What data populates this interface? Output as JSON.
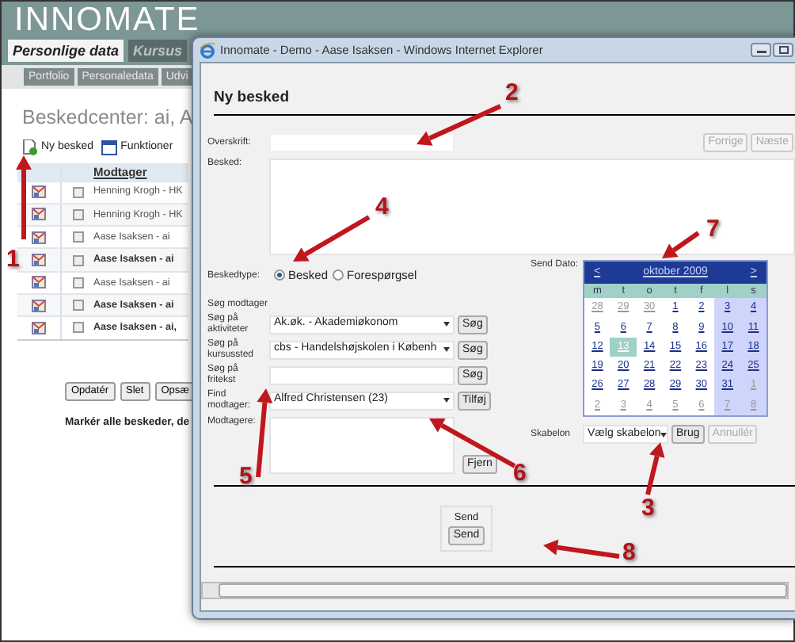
{
  "app": {
    "logo": "INNOMATE",
    "tabs": [
      {
        "label": "Personlige data",
        "selected": true
      },
      {
        "label": "Kursus",
        "selected": false
      }
    ],
    "subtabs": [
      "Portfolio",
      "Personaledata",
      "Udvi"
    ],
    "title": "Beskedcenter: ai, A",
    "toolbar": [
      {
        "label": "Ny besked",
        "kind": "new"
      },
      {
        "label": "Funktioner",
        "kind": "functions"
      }
    ],
    "table": {
      "columns": [
        "Modtager"
      ],
      "rows": [
        {
          "recipient": "Henning Krogh - HK",
          "unread": false,
          "checked": false
        },
        {
          "recipient": "Henning Krogh - HK",
          "unread": false,
          "checked": false
        },
        {
          "recipient": "Aase Isaksen - ai",
          "unread": false,
          "checked": false
        },
        {
          "recipient": "Aase Isaksen - ai",
          "unread": true,
          "checked": false
        },
        {
          "recipient": "Aase Isaksen - ai",
          "unread": false,
          "checked": false
        },
        {
          "recipient": "Aase Isaksen - ai",
          "unread": true,
          "checked": false
        },
        {
          "recipient": "Aase Isaksen - ai,",
          "unread": true,
          "checked": false
        }
      ]
    },
    "buttons": [
      "Opdatér",
      "Slet",
      "Opsæ"
    ],
    "note": "Markér alle beskeder, de"
  },
  "window": {
    "title": "Innomate - Demo - Aase Isaksen - Windows Internet Explorer",
    "heading": "Ny besked",
    "overskrift": {
      "label": "Overskrift:"
    },
    "nav_buttons": [
      {
        "label": "Forrige",
        "disabled": true
      },
      {
        "label": "Næste",
        "disabled": true
      }
    ],
    "besked": {
      "label": "Besked:"
    },
    "type": {
      "label": "Beskedtype:",
      "options": [
        {
          "label": "Besked",
          "selected": true
        },
        {
          "label": "Forespørgsel",
          "selected": false
        }
      ]
    },
    "search_title": "Søg modtager",
    "search_rows": [
      {
        "kind": "select",
        "label": "Søg på aktiviteter",
        "value": "Ak.øk. - Akademiøkonom",
        "button": "Søg"
      },
      {
        "kind": "select",
        "label": "Søg på kursussted",
        "value": "cbs - Handelshøjskolen i Københ",
        "button": "Søg"
      },
      {
        "kind": "input",
        "label": "Søg på fritekst",
        "button": "Søg"
      },
      {
        "kind": "select",
        "label": "Find modtager:",
        "value": "Alfred Christensen (23)",
        "button": "Tilføj"
      },
      {
        "kind": "list",
        "label": "Modtagere:",
        "button": "Fjern"
      }
    ],
    "send_date": {
      "label": "Send Dato:",
      "calendar": {
        "prev": "<",
        "month": "oktober 2009",
        "next": ">",
        "weekdays": [
          "m",
          "t",
          "o",
          "t",
          "f",
          "l",
          "s"
        ],
        "weeks": [
          [
            {
              "day": "28",
              "other_month": true,
              "selected": false
            },
            {
              "day": "29",
              "other_month": true,
              "selected": false
            },
            {
              "day": "30",
              "other_month": true,
              "selected": false
            },
            {
              "day": "1",
              "other_month": false,
              "selected": false
            },
            {
              "day": "2",
              "other_month": false,
              "selected": false
            },
            {
              "day": "3",
              "other_month": false,
              "selected": false
            },
            {
              "day": "4",
              "other_month": false,
              "selected": false
            }
          ],
          [
            {
              "day": "5",
              "other_month": false,
              "selected": false
            },
            {
              "day": "6",
              "other_month": false,
              "selected": false
            },
            {
              "day": "7",
              "other_month": false,
              "selected": false
            },
            {
              "day": "8",
              "other_month": false,
              "selected": false
            },
            {
              "day": "9",
              "other_month": false,
              "selected": false
            },
            {
              "day": "10",
              "other_month": false,
              "selected": false
            },
            {
              "day": "11",
              "other_month": false,
              "selected": false
            }
          ],
          [
            {
              "day": "12",
              "other_month": false,
              "selected": false
            },
            {
              "day": "13",
              "other_month": false,
              "selected": true
            },
            {
              "day": "14",
              "other_month": false,
              "selected": false
            },
            {
              "day": "15",
              "other_month": false,
              "selected": false
            },
            {
              "day": "16",
              "other_month": false,
              "selected": false
            },
            {
              "day": "17",
              "other_month": false,
              "selected": false
            },
            {
              "day": "18",
              "other_month": false,
              "selected": false
            }
          ],
          [
            {
              "day": "19",
              "other_month": false,
              "selected": false
            },
            {
              "day": "20",
              "other_month": false,
              "selected": false
            },
            {
              "day": "21",
              "other_month": false,
              "selected": false
            },
            {
              "day": "22",
              "other_month": false,
              "selected": false
            },
            {
              "day": "23",
              "other_month": false,
              "selected": false
            },
            {
              "day": "24",
              "other_month": false,
              "selected": false
            },
            {
              "day": "25",
              "other_month": false,
              "selected": false
            }
          ],
          [
            {
              "day": "26",
              "other_month": false,
              "selected": false
            },
            {
              "day": "27",
              "other_month": false,
              "selected": false
            },
            {
              "day": "28",
              "other_month": false,
              "selected": false
            },
            {
              "day": "29",
              "other_month": false,
              "selected": false
            },
            {
              "day": "30",
              "other_month": false,
              "selected": false
            },
            {
              "day": "31",
              "other_month": false,
              "selected": false
            },
            {
              "day": "1",
              "other_month": true,
              "selected": false
            }
          ],
          [
            {
              "day": "2",
              "other_month": true,
              "selected": false
            },
            {
              "day": "3",
              "other_month": true,
              "selected": false
            },
            {
              "day": "4",
              "other_month": true,
              "selected": false
            },
            {
              "day": "5",
              "other_month": true,
              "selected": false
            },
            {
              "day": "6",
              "other_month": true,
              "selected": false
            },
            {
              "day": "7",
              "other_month": true,
              "selected": false
            },
            {
              "day": "8",
              "other_month": true,
              "selected": false
            }
          ]
        ]
      }
    },
    "template": {
      "label": "Skabelon",
      "value": "Vælg skabelon",
      "buttons": [
        {
          "label": "Brug",
          "disabled": false
        },
        {
          "label": "Annullér",
          "disabled": true
        }
      ]
    },
    "send": {
      "legend": "Send",
      "button": "Send"
    }
  },
  "annotations": [
    {
      "number": "1"
    },
    {
      "number": "2"
    },
    {
      "number": "4"
    },
    {
      "number": "7"
    },
    {
      "number": "5"
    },
    {
      "number": "6"
    },
    {
      "number": "3"
    },
    {
      "number": "8"
    }
  ]
}
